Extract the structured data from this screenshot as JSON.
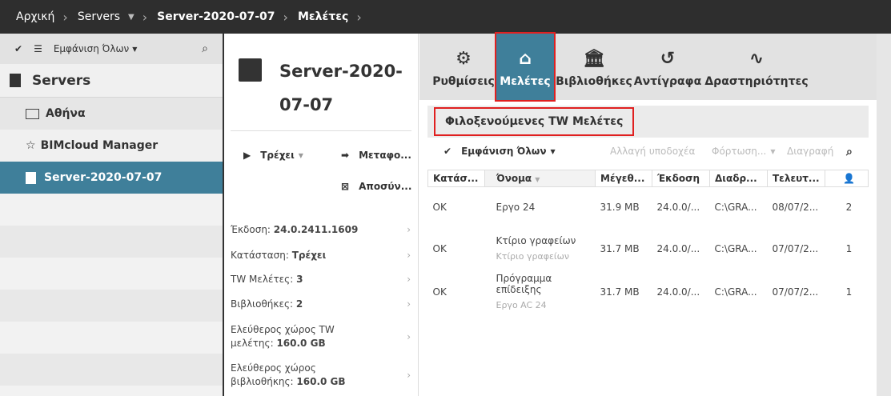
{
  "breadcrumb": {
    "home": "Αρχική",
    "servers": "Servers",
    "server": "Server-2020-07-07",
    "current": "Μελέτες"
  },
  "sidebar": {
    "filter": "Εμφάνιση Όλων",
    "header": "Servers",
    "items": [
      {
        "label": "Αθήνα"
      },
      {
        "label": "BIMcloud Manager"
      },
      {
        "label": "Server-2020-07-07"
      }
    ]
  },
  "server": {
    "title_line1": "Server-2020-",
    "title_line2": "07-07",
    "run": "Τρέχει",
    "migrate": "Μεταφο...",
    "disconnect": "Αποσύν...",
    "info": [
      {
        "label": "Έκδοση: ",
        "value": "24.0.2411.1609"
      },
      {
        "label": "Κατάσταση: ",
        "value": "Τρέχει"
      },
      {
        "label": "TW Μελέτες: ",
        "value": "3"
      },
      {
        "label": "Βιβλιοθήκες: ",
        "value": "2"
      },
      {
        "label": "Ελεύθερος χώρος TW μελέτης: ",
        "value": "160.0 GB"
      },
      {
        "label": "Ελεύθερος χώρος βιβλιοθήκης: ",
        "value": "160.0 GB"
      }
    ]
  },
  "tabs": [
    "Ρυθμίσεις",
    "Μελέτες",
    "Βιβλιοθήκες",
    "Αντίγραφα",
    "Δραστηριότητες"
  ],
  "section": {
    "title": "Φιλοξενούμενες TW Μελέτες",
    "filter": "Εμφάνιση Όλων",
    "change_host": "Αλλαγή υποδοχέα",
    "upload": "Φόρτωση...",
    "delete": "Διαγραφή"
  },
  "table": {
    "headers": [
      "Κατάσ...",
      "Όνομα",
      "Μέγεθ...",
      "Έκδοση",
      "Διαδρ...",
      "Τελευτ..."
    ],
    "rows": [
      {
        "status": "OK",
        "name": "Εργο 24",
        "sub": "",
        "size": "31.9 MB",
        "version": "24.0.0/...",
        "path": "C:\\GRA...",
        "last": "08/07/2...",
        "users": "2"
      },
      {
        "status": "OK",
        "name": "Κτίριο γραφείων",
        "sub": "Κτίριο γραφείων",
        "size": "31.7 MB",
        "version": "24.0.0/...",
        "path": "C:\\GRA...",
        "last": "07/07/2...",
        "users": "1"
      },
      {
        "status": "OK",
        "name": "Πρόγραμμα επίδειξης",
        "sub": "Εργο AC 24",
        "size": "31.7 MB",
        "version": "24.0.0/...",
        "path": "C:\\GRA...",
        "last": "07/07/2...",
        "users": "1"
      }
    ]
  }
}
